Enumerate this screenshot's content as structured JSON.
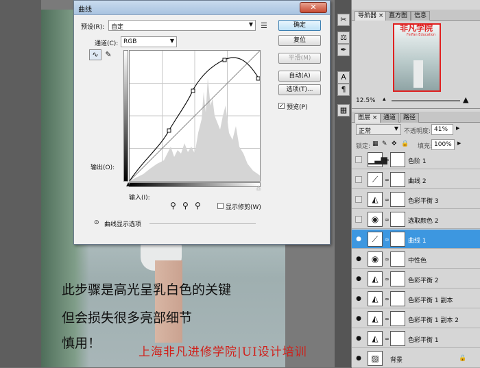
{
  "photo": {
    "caption_lines": [
      "此步骤是高光呈乳白色的关键",
      "但会损失很多亮部细节",
      "慎用！"
    ],
    "watermark": "上海非凡进修学院|UI设计培训"
  },
  "dialog": {
    "title": "曲线",
    "preset_label": "预设(R):",
    "preset_value": "自定",
    "channel_label": "通道(C):",
    "channel_value": "RGB",
    "output_label": "输出(O):",
    "input_label": "输入(I):",
    "show_clipping_label": "显示修剪(W)",
    "curve_options_label": "曲线显示选项",
    "buttons": {
      "ok": "确定",
      "reset": "复位",
      "smooth": "平滑(M)",
      "auto": "自动(A)",
      "options": "选项(T)...",
      "preview": "预览(P)"
    },
    "preview_checked": true,
    "show_clipping_checked": false
  },
  "navigator": {
    "tabs": [
      "导航器",
      "直方图",
      "信息"
    ],
    "logo_text": "非凡学院",
    "logo_sub": "FeiFan Education",
    "zoom": "12.5%"
  },
  "layers_panel": {
    "tabs": [
      "图层",
      "通道",
      "路径"
    ],
    "blend_mode": "正常",
    "opacity_label": "不透明度:",
    "opacity": "41%",
    "lock_label": "锁定:",
    "fill_label": "填充:",
    "fill": "100%",
    "layers": [
      {
        "name": "色阶 1",
        "visible": false,
        "icon": "levels-icon",
        "selected": false
      },
      {
        "name": "曲线 2",
        "visible": false,
        "icon": "curves-icon",
        "selected": false
      },
      {
        "name": "色彩平衡 3",
        "visible": false,
        "icon": "color-balance-icon",
        "selected": false
      },
      {
        "name": "选取颜色 2",
        "visible": false,
        "icon": "selective-color-icon",
        "selected": false
      },
      {
        "name": "曲线 1",
        "visible": true,
        "icon": "curves-icon",
        "selected": true
      },
      {
        "name": "中性色",
        "visible": true,
        "icon": "selective-color-icon",
        "selected": false
      },
      {
        "name": "色彩平衡 2",
        "visible": true,
        "icon": "color-balance-icon",
        "selected": false
      },
      {
        "name": "色彩平衡 1 副本",
        "visible": true,
        "icon": "color-balance-icon",
        "selected": false
      },
      {
        "name": "色彩平衡 1 副本 2",
        "visible": true,
        "icon": "color-balance-icon",
        "selected": false
      },
      {
        "name": "色彩平衡 1",
        "visible": true,
        "icon": "color-balance-icon",
        "selected": false
      },
      {
        "name": "背景",
        "visible": true,
        "icon": "background-icon",
        "selected": false
      }
    ]
  },
  "colors": {
    "accent": "#3d97e0",
    "watermark": "#d0201a",
    "logo": "#e02020"
  }
}
